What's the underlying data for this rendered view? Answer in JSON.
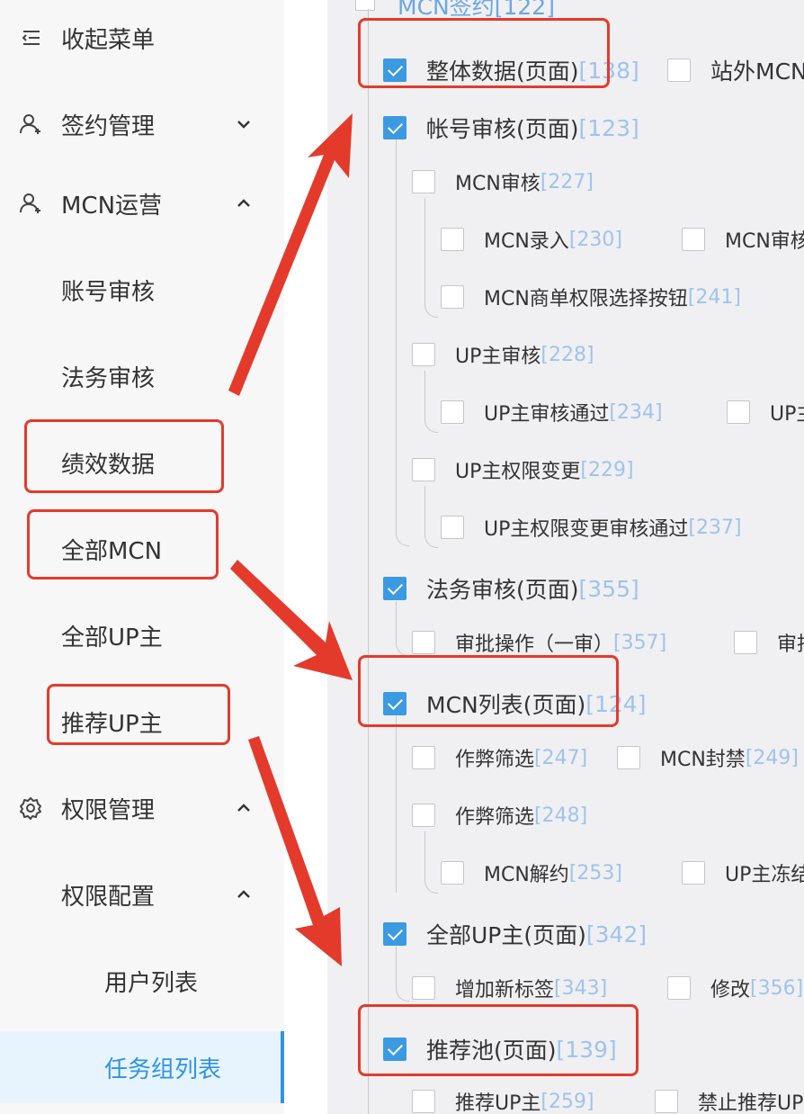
{
  "sidebar": {
    "collapse": "收起菜单",
    "sign": "签约管理",
    "mcn_ops": "MCN运营",
    "account_review": "账号审核",
    "legal_review": "法务审核",
    "performance": "绩效数据",
    "all_mcn": "全部MCN",
    "all_up": "全部UP主",
    "recommend_up": "推荐UP主",
    "permission": "权限管理",
    "permission_config": "权限配置",
    "user_list": "用户列表",
    "task_group_list": "任务组列表"
  },
  "tree": {
    "top_partial": "MCN签约[122]",
    "n1": {
      "label": "整体数据(页面)",
      "num": "[138]"
    },
    "n1b": {
      "label": "站外MCN",
      "num": ""
    },
    "n2": {
      "label": "帐号审核(页面)",
      "num": "[123]"
    },
    "n3": {
      "label": "MCN审核",
      "num": "[227]"
    },
    "n4": {
      "label": "MCN录入",
      "num": "[230]"
    },
    "n5": {
      "label": "MCN审核",
      "num": ""
    },
    "n6": {
      "label": "MCN商单权限选择按钮",
      "num": "[241]"
    },
    "n7": {
      "label": "UP主审核",
      "num": "[228]"
    },
    "n8": {
      "label": "UP主审核通过",
      "num": "[234]"
    },
    "n9": {
      "label": "UP主",
      "num": ""
    },
    "n10": {
      "label": "UP主权限变更",
      "num": "[229]"
    },
    "n11": {
      "label": "UP主权限变更审核通过",
      "num": "[237]"
    },
    "n12": {
      "label": "法务审核(页面)",
      "num": "[355]"
    },
    "n13": {
      "label": "审批操作（一审）",
      "num": "[357]"
    },
    "n14": {
      "label": "审批",
      "num": ""
    },
    "n15": {
      "label": "MCN列表(页面)",
      "num": "[124]"
    },
    "n16": {
      "label": "作弊筛选",
      "num": "[247]"
    },
    "n17": {
      "label": "MCN封禁",
      "num": "[249]"
    },
    "n18": {
      "label": "作弊筛选",
      "num": "[248]"
    },
    "n19": {
      "label": "MCN解约",
      "num": "[253]"
    },
    "n20": {
      "label": "UP主冻结",
      "num": ""
    },
    "n21": {
      "label": "全部UP主(页面)",
      "num": "[342]"
    },
    "n22": {
      "label": "增加新标签",
      "num": "[343]"
    },
    "n23": {
      "label": "修改",
      "num": "[356]"
    },
    "n24": {
      "label": "推荐池(页面)",
      "num": "[139]"
    },
    "n25": {
      "label": "推荐UP主",
      "num": "[259]"
    },
    "n26": {
      "label": "禁止推荐UP",
      "num": ""
    }
  },
  "colors": {
    "accent": "#3b9ae1",
    "annotation": "#e43a2b",
    "number": "#9fc3ee"
  }
}
